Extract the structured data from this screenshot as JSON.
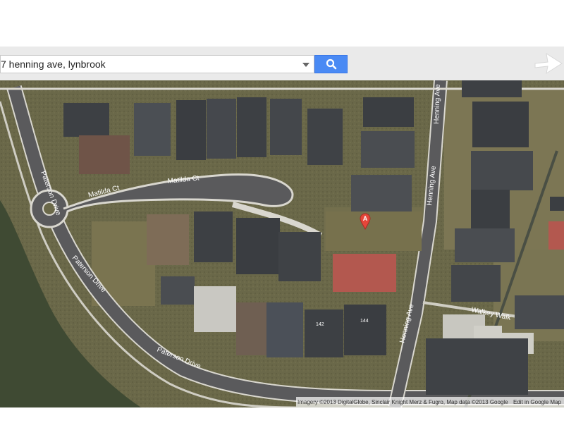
{
  "search": {
    "value": "7 henning ave, lynbrook",
    "search_icon": "search-icon",
    "dropdown_icon": "chevron-down-icon"
  },
  "map": {
    "view": "satellite",
    "marker": {
      "label": "A",
      "color": "#e5463a"
    },
    "streets": {
      "paterson_drive": "Paterson Drive",
      "matilda_ct": "Matilda Ct",
      "henning_ave": "Henning Ave",
      "walkey_walk": "Walkey Walk"
    },
    "house_numbers": {
      "n142": "142",
      "n144": "144"
    }
  },
  "attribution": {
    "imagery": "Imagery ©2013 DigitalGlobe, Sinclair Knight Merz & Fugro, Map data ©2013 Google",
    "edit": "Edit in Google Map"
  },
  "colors": {
    "search_button": "#4a8af4",
    "toolbar": "#eaeaea",
    "marker": "#e5463a",
    "roof_red": "#b3584f",
    "roof_dark": "#3d4044"
  }
}
